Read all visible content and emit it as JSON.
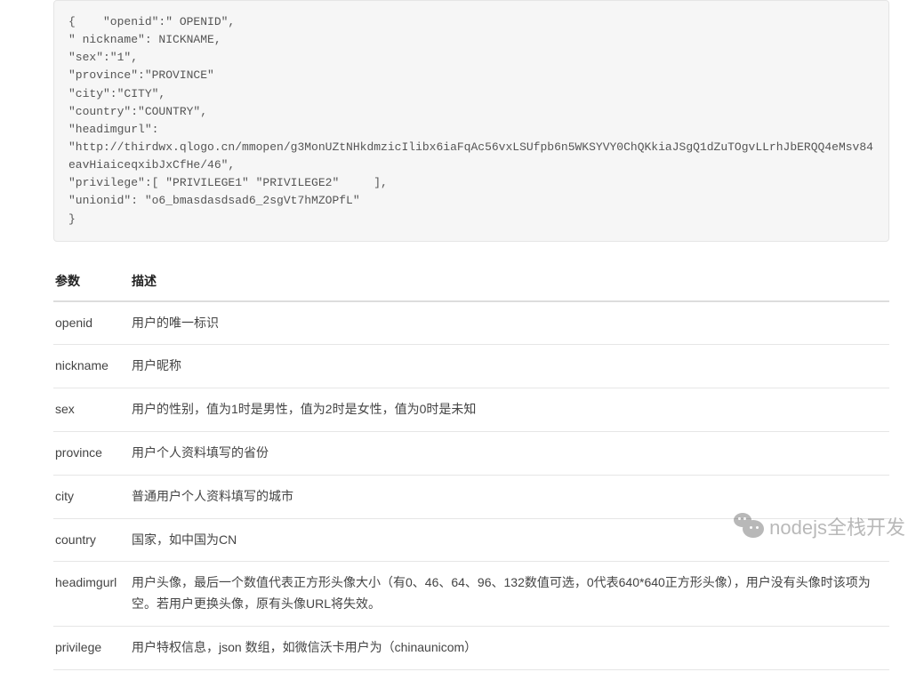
{
  "code_block": "{    \"openid\":\" OPENID\",\n\" nickname\": NICKNAME,\n\"sex\":\"1\",\n\"province\":\"PROVINCE\"\n\"city\":\"CITY\",\n\"country\":\"COUNTRY\",\n\"headimgurl\":\n\"http://thirdwx.qlogo.cn/mmopen/g3MonUZtNHkdmzicIlibx6iaFqAc56vxLSUfpb6n5WKSYVY0ChQKkiaJSgQ1dZuTOgvLLrhJbERQQ4eMsv84eavHiaiceqxibJxCfHe/46\",\n\"privilege\":[ \"PRIVILEGE1\" \"PRIVILEGE2\"     ],\n\"unionid\": \"o6_bmasdasdsad6_2sgVt7hMZOPfL\"\n}",
  "table": {
    "headers": {
      "param": "参数",
      "desc": "描述"
    },
    "rows": [
      {
        "param": "openid",
        "desc": "用户的唯一标识"
      },
      {
        "param": "nickname",
        "desc": "用户昵称"
      },
      {
        "param": "sex",
        "desc": "用户的性别，值为1时是男性，值为2时是女性，值为0时是未知"
      },
      {
        "param": "province",
        "desc": "用户个人资料填写的省份"
      },
      {
        "param": "city",
        "desc": "普通用户个人资料填写的城市"
      },
      {
        "param": "country",
        "desc": "国家，如中国为CN"
      },
      {
        "param": "headimgurl",
        "desc": "用户头像，最后一个数值代表正方形头像大小（有0、46、64、96、132数值可选，0代表640*640正方形头像），用户没有头像时该项为空。若用户更换头像，原有头像URL将失效。"
      },
      {
        "param": "privilege",
        "desc": "用户特权信息，json 数组，如微信沃卡用户为（chinaunicom）"
      }
    ]
  },
  "watermark": {
    "text": "nodejs全栈开发"
  }
}
